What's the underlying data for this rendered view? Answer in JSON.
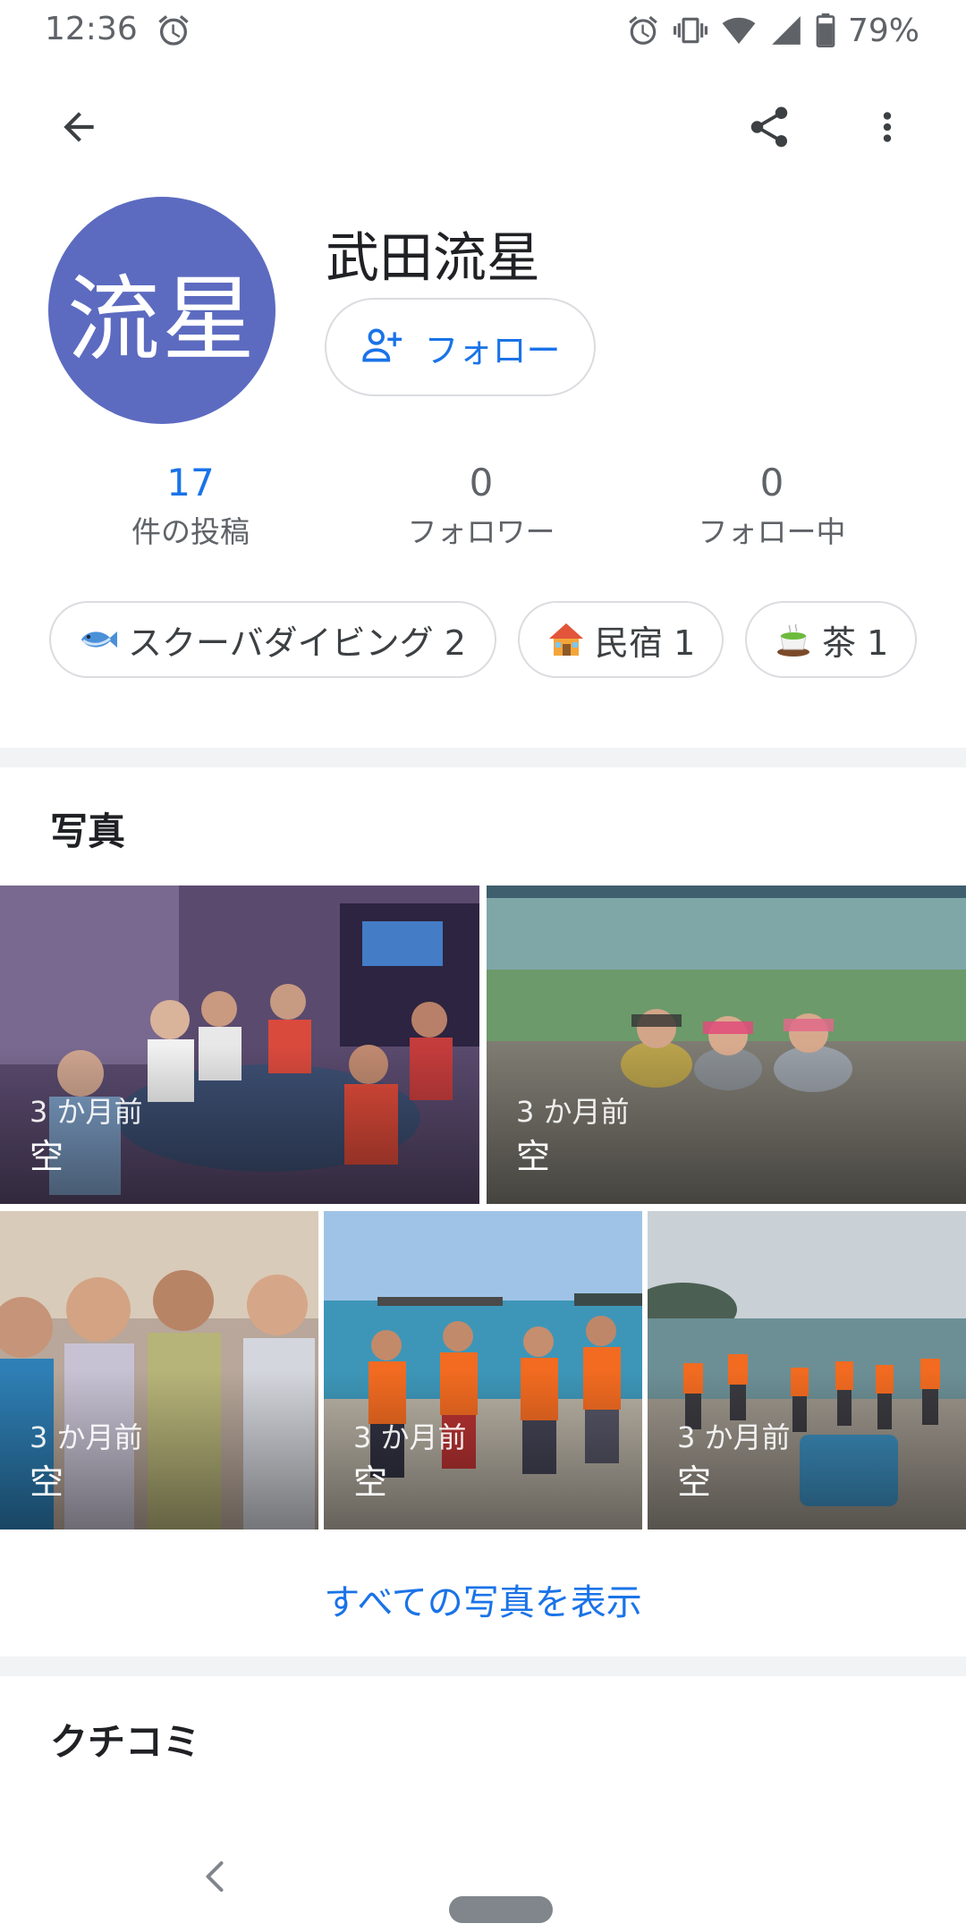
{
  "status_bar": {
    "time": "12:36",
    "battery": "79%",
    "icons": [
      "alarm-icon",
      "vibrate-icon",
      "wifi-icon",
      "signal-icon",
      "battery-icon"
    ]
  },
  "app_bar": {
    "icons": [
      "back-arrow-icon",
      "share-icon",
      "more-vert-icon"
    ]
  },
  "profile": {
    "avatar_text": "流星",
    "avatar_color": "#5c6bc0",
    "name": "武田流星",
    "follow_label": "フォロー"
  },
  "stats": [
    {
      "value": "17",
      "label": "件の投稿"
    },
    {
      "value": "0",
      "label": "フォロワー"
    },
    {
      "value": "0",
      "label": "フォロー中"
    }
  ],
  "chips": [
    {
      "icon": "fish-icon",
      "label": "スクーバダイビング 2"
    },
    {
      "icon": "house-icon",
      "label": "民宿 1"
    },
    {
      "icon": "tea-icon",
      "label": "茶 1"
    }
  ],
  "photos_section": {
    "title": "写真",
    "items": [
      {
        "time": "3 か月前",
        "place": "空"
      },
      {
        "time": "3 か月前",
        "place": "空"
      },
      {
        "time": "3 か月前",
        "place": "空"
      },
      {
        "time": "3 か月前",
        "place": "空"
      },
      {
        "time": "3 か月前",
        "place": "空"
      }
    ],
    "view_all": "すべての写真を表示"
  },
  "reviews_section": {
    "title": "クチコミ"
  },
  "colors": {
    "accent": "#1a73e8",
    "divider": "#f1f3f4"
  }
}
